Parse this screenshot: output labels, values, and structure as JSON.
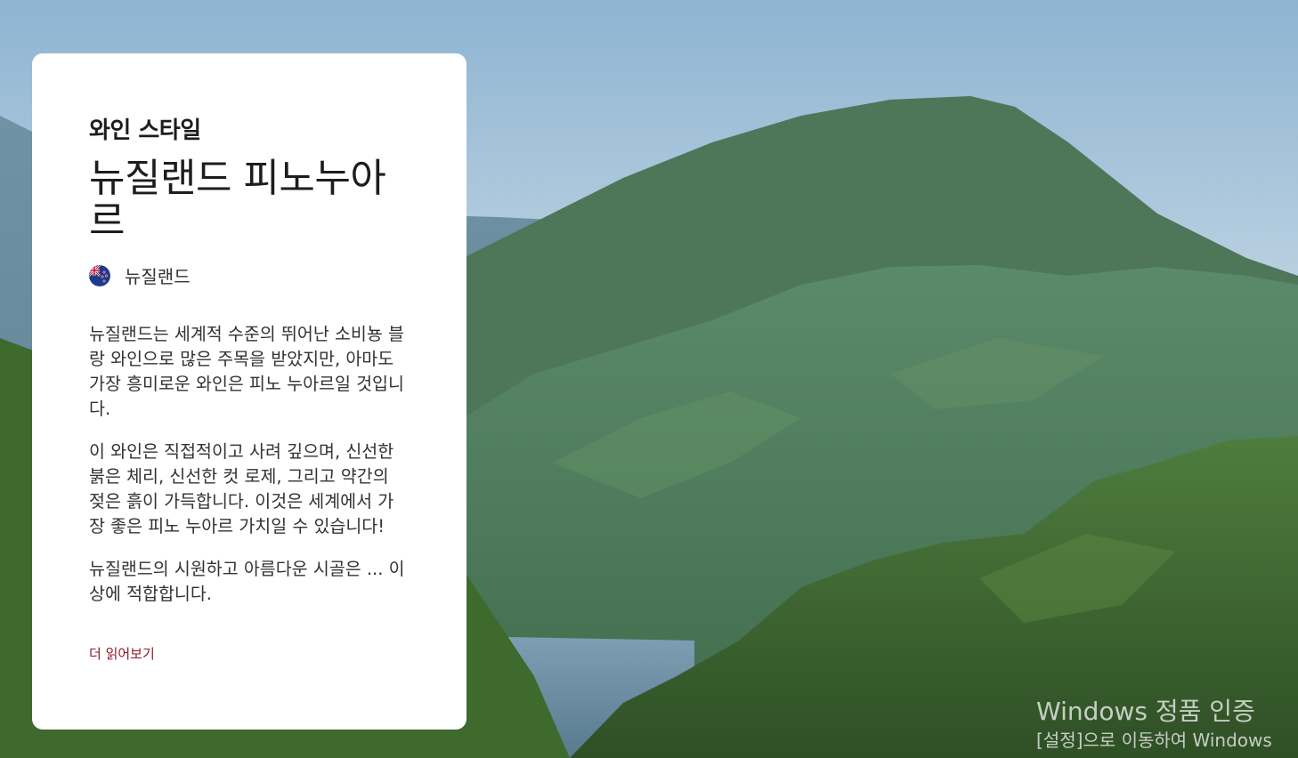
{
  "hero": {
    "image_alt": "mountain-landscape-image"
  },
  "card": {
    "eyebrow": "와인 스타일",
    "title": "뉴질랜드 피노누아르",
    "country": "뉴질랜드",
    "paragraphs": [
      "뉴질랜드는 세계적 수준의 뛰어난 소비뇽 블랑 와인으로 많은 주목을 받았지만, 아마도 가장 흥미로운 와인은 피노 누아르일 것입니다.",
      "이 와인은 직접적이고 사려 깊으며, 신선한 붉은 체리, 신선한 컷 로제, 그리고 약간의 젖은 흙이 가득합니다. 이것은 세계에서 가장 좋은 피노 누아르 가치일 수 있습니다!",
      "뉴질랜드의 시원하고 아름다운 시골은 ... 이상에 적합합니다."
    ],
    "read_more": "더 읽어보기"
  },
  "watermark": {
    "line1": "Windows 정품 인증",
    "line2": "[설정]으로 이동하여 Windows"
  },
  "colors": {
    "accent": "#8b1a2b",
    "card_bg": "#ffffff"
  }
}
